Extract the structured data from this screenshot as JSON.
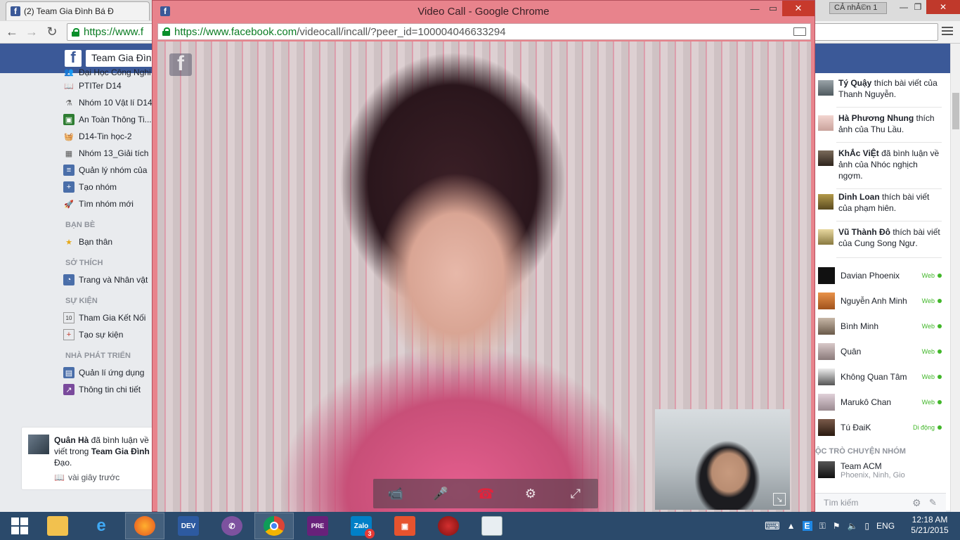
{
  "browser": {
    "tab_title": "(2) Team Gia Đình Bá Đ",
    "user_chip": "CẢ nhẢ©n 1",
    "omnibox_url": "https://www.f"
  },
  "facebook": {
    "search_value": "Team Gia Đình",
    "left_col": {
      "items_top": [
        {
          "label": "Đại Học Công Nghi",
          "icon": "group-icon"
        },
        {
          "label": "PTITer D14",
          "icon": "book-icon"
        },
        {
          "label": "Nhóm 10 Vật lí D14",
          "icon": "flask-icon"
        },
        {
          "label": "An Toàn Thông Ti...",
          "icon": "shield-icon"
        },
        {
          "label": "D14-Tin học-2",
          "icon": "basket-icon"
        },
        {
          "label": "Nhóm 13_Giải tích",
          "icon": "calculator-icon"
        },
        {
          "label": "Quản lý nhóm của",
          "icon": "manage-icon"
        },
        {
          "label": "Tạo nhóm",
          "icon": "plus-icon"
        },
        {
          "label": "Tìm nhóm mới",
          "icon": "rocket-icon"
        }
      ],
      "section_friends": "BẠN BÈ",
      "friends_items": [
        {
          "label": "Bạn thân",
          "icon": "star-icon"
        }
      ],
      "section_interests": "SỞ THÍCH",
      "interests_items": [
        {
          "label": "Trang và Nhân vật",
          "icon": "rss-icon"
        }
      ],
      "section_events": "SỰ KIỆN",
      "events_items": [
        {
          "label": "Tham Gia Kết Nối",
          "icon": "calendar-icon",
          "badge": "10"
        },
        {
          "label": "Tạo sự kiện",
          "icon": "add-event-icon"
        }
      ],
      "section_developers": "NHÀ PHÁT TRIỂN",
      "dev_items": [
        {
          "label": "Quản lí ứng dụng",
          "icon": "apps-icon"
        },
        {
          "label": "Thông tin chi tiết",
          "icon": "insights-icon"
        }
      ]
    },
    "notification": {
      "actor": "Quân Hà",
      "text_1": " đã bình luận về",
      "text_2": "viết trong ",
      "group": "Team Gia Đình",
      "text_3": "Đạo.",
      "time": "vài giây trước"
    },
    "ticker": [
      {
        "actor": "Tý Quậy",
        "text": " thích bài viết của Thanh Nguyễn."
      },
      {
        "actor": "Hà Phương Nhung",
        "text": " thích ảnh của Thu Lầu."
      },
      {
        "actor": "KhẮc ViỆt",
        "text": " đã bình luận về ảnh của Nhóc nghịch ngợm."
      },
      {
        "actor": "Dinh Loan",
        "text": " thích bài viết của phạm hiên."
      },
      {
        "actor": "Vũ Thành Đô",
        "text": " thích bài viết của Cung Song Ngư."
      }
    ],
    "contacts": [
      {
        "name": "Davian Phoenix",
        "status": "Web"
      },
      {
        "name": "Nguyễn Anh Minh",
        "status": "Web"
      },
      {
        "name": "Bình Minh",
        "status": "Web"
      },
      {
        "name": "Quân",
        "status": "Web"
      },
      {
        "name": "Không Quan Tâm",
        "status": "Web"
      },
      {
        "name": "Marukô Chan",
        "status": "Web"
      },
      {
        "name": "Tú ĐaiK",
        "status": "Di động"
      }
    ],
    "group_chats_header": "ỘC TRÒ CHUYỆN NHÓM",
    "group_chat": {
      "name": "Team ACM",
      "members": "Phoenix, Ninh, Gio"
    },
    "chat_search_placeholder": "Tìm kiếm"
  },
  "popup": {
    "title": "Video Call - Google Chrome",
    "url_host": "https://www.facebook.com",
    "url_path": "/videocall/incall/?peer_id=100004046633294"
  },
  "taskbar": {
    "apps": [
      "File Explorer",
      "Internet Explorer",
      "Firefox",
      "Dev-C++",
      "Viber",
      "Chrome",
      "Visual Studio Preview",
      "Zalo",
      "Office",
      "Red Envelope",
      "Presentation"
    ],
    "zalo_badge": "3",
    "lang": "ENG",
    "time": "12:18 AM",
    "date": "5/21/2015"
  },
  "colors": {
    "facebook_blue": "#3b5998",
    "online_green": "#42b72a",
    "popup_frame": "#e8838c",
    "end_call_red": "#e0243d",
    "taskbar": "#2b4a6b"
  }
}
